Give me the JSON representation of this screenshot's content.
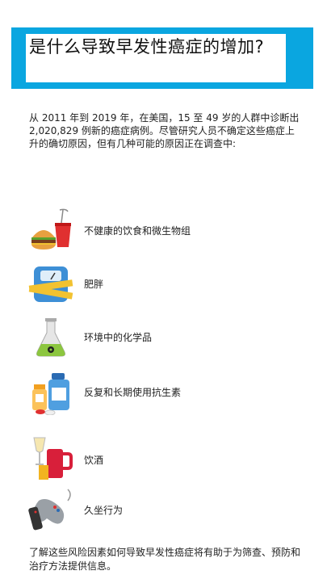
{
  "header": {
    "title": "是什么导致早发性癌症的增加?",
    "banner_color": "#0aa6e0"
  },
  "intro": "从 2011 年到 2019 年，在美国，15 至 49 岁的人群中诊断出 2,020,829 例新的癌症病例。尽管研究人员不确定这些癌症上升的确切原因，但有几种可能的原因正在调查中:",
  "factors": [
    {
      "label": "不健康的饮食和微生物组",
      "icon": "fast-food-icon"
    },
    {
      "label": "肥胖",
      "icon": "scale-measuring-tape-icon"
    },
    {
      "label": "环境中的化学品",
      "icon": "chemical-flask-icon"
    },
    {
      "label": "反复和长期使用抗生素",
      "icon": "medicine-bottles-icon"
    },
    {
      "label": "饮酒",
      "icon": "alcohol-drinks-icon"
    },
    {
      "label": "久坐行为",
      "icon": "game-controller-remote-icon"
    }
  ],
  "outro": "了解这些风险因素如何导致早发性癌症将有助于为筛查、预防和治疗方法提供信息。"
}
